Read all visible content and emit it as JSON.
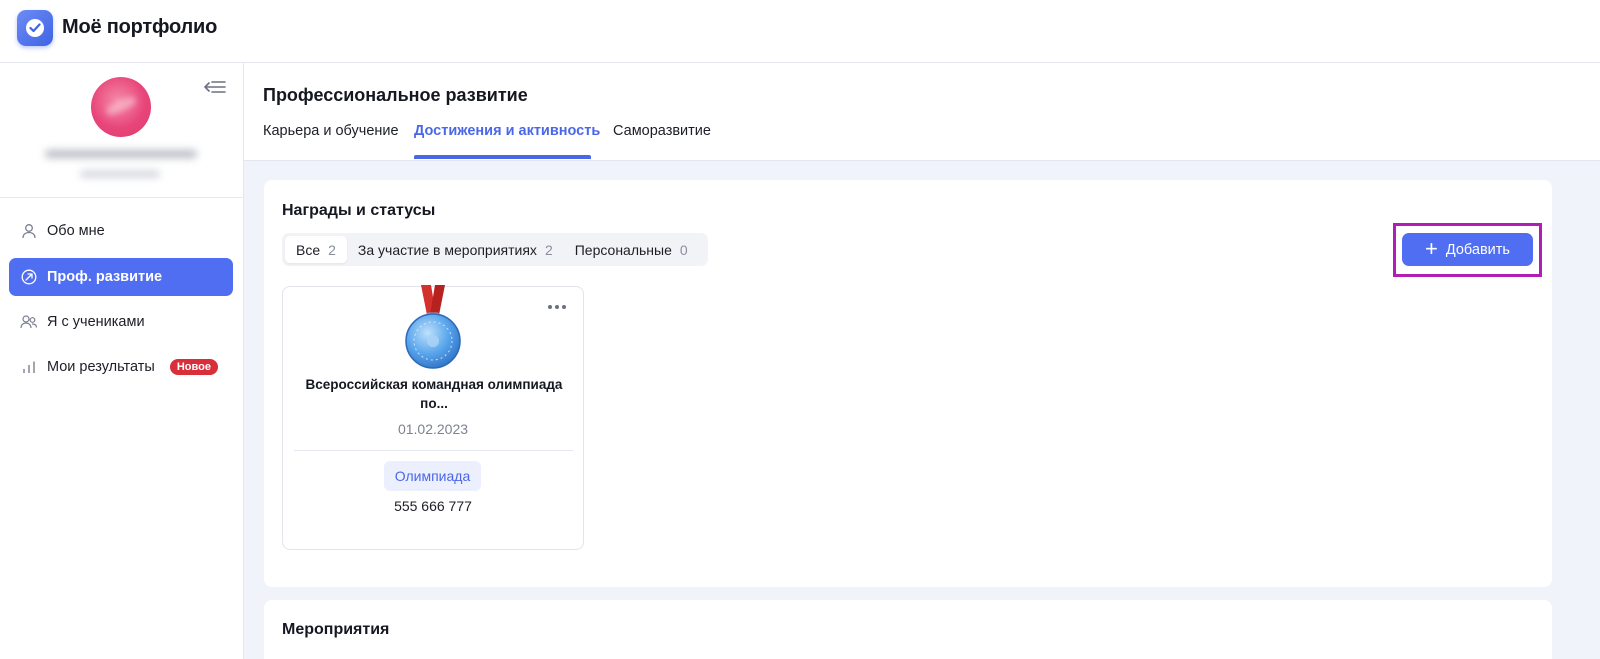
{
  "app": {
    "title": "Моё портфолио"
  },
  "sidebar": {
    "items": [
      {
        "label": "Обо мне",
        "icon": "user-icon"
      },
      {
        "label": "Проф. развитие",
        "icon": "growth-arrow-icon",
        "active": true
      },
      {
        "label": "Я с учениками",
        "icon": "users-icon"
      },
      {
        "label": "Мои результаты",
        "icon": "bar-chart-icon",
        "badge": "Новое"
      }
    ]
  },
  "main": {
    "title": "Профессиональное развитие",
    "tabs": [
      {
        "label": "Карьера и обучение"
      },
      {
        "label": "Достижения и активность",
        "active": true
      },
      {
        "label": "Саморазвитие"
      }
    ]
  },
  "awards": {
    "title": "Награды и статусы",
    "filters": [
      {
        "label": "Все",
        "count": "2",
        "active": true
      },
      {
        "label": "За участие в мероприятиях",
        "count": "2"
      },
      {
        "label": "Персональные",
        "count": "0"
      }
    ],
    "add_label": "Добавить",
    "cards": [
      {
        "name": "Всероссийская командная олимпиада по...",
        "date": "01.02.2023",
        "tag": "Олимпиада",
        "number": "555 666 777",
        "icon": "medal-icon"
      }
    ]
  },
  "events": {
    "title": "Мероприятия"
  },
  "colors": {
    "accent": "#4f6ef2",
    "accent_text": "#4a67e8",
    "badge": "#d92f3a",
    "highlight_border": "#b01eb5",
    "content_bg": "#f1f3fb"
  }
}
